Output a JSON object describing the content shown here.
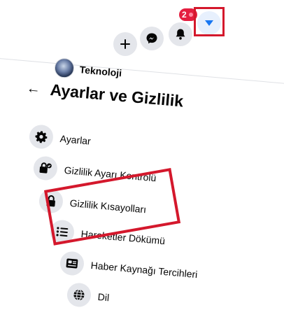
{
  "header": {
    "profile_name": "Teknoloji",
    "notification_count": "2",
    "buttons": [
      "create-button",
      "messenger-button",
      "notifications-button",
      "account-menu-button"
    ]
  },
  "settings_panel": {
    "title": "Ayarlar ve Gizlilik",
    "items": [
      {
        "label": "Ayarlar",
        "icon": "gear-icon"
      },
      {
        "label": "Gizlilik Ayarı Kontrolü",
        "icon": "lock-check-icon"
      },
      {
        "label": "Gizlilik Kısayolları",
        "icon": "lock-icon"
      },
      {
        "label": "Hareketler Dökümü",
        "icon": "list-icon"
      },
      {
        "label": "Haber Kaynağı Tercihleri",
        "icon": "news-feed-icon"
      },
      {
        "label": "Dil",
        "icon": "globe-icon"
      }
    ]
  },
  "colors": {
    "highlight": "#d4182c",
    "icon_bg": "#e4e6eb",
    "badge": "#e41e3f",
    "accent": "#1877f2"
  }
}
